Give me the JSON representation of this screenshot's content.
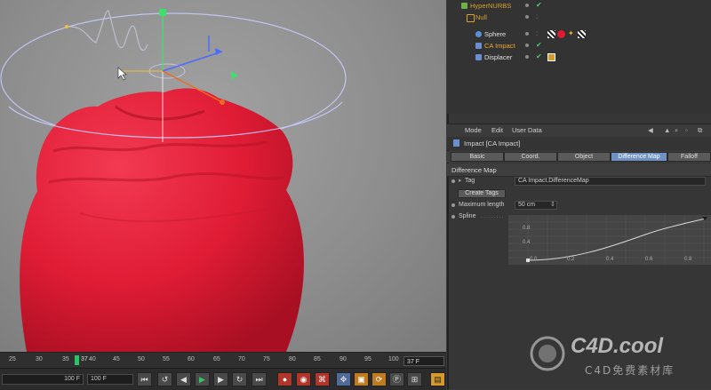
{
  "object_manager": {
    "rows": [
      {
        "name": "HyperNURBS",
        "color": "#d8a22a"
      },
      {
        "name": "Null",
        "color": "#d8a22a"
      },
      {
        "name": "Sphere",
        "color": "#e0e0e0"
      },
      {
        "name": "CA Impact",
        "color": "#f0a830"
      },
      {
        "name": "Displacer",
        "color": "#e0e0e0"
      }
    ]
  },
  "attributes": {
    "menu": [
      "Mode",
      "Edit",
      "User Data"
    ],
    "title": "Impact [CA Impact]",
    "tabs": [
      "Basic",
      "Coord.",
      "Object",
      "Difference Map",
      "Falloff"
    ],
    "active_tab": "Difference Map",
    "section_title": "Difference Map",
    "tag_label": "Tag",
    "tag_value": "CA Impact.DifferenceMap",
    "create_tags_label": "Create Tags",
    "max_length_label": "Maximum length",
    "max_length_value": "50 cm",
    "spline_label": "Spline",
    "spline_y_ticks": [
      "0.8",
      "0.4"
    ],
    "spline_x_ticks": [
      "0.0",
      "0.2",
      "0.4",
      "0.6",
      "0.8"
    ]
  },
  "timeline": {
    "ticks": [
      "25",
      "30",
      "35",
      "37",
      "40",
      "45",
      "50",
      "55",
      "60",
      "65",
      "70",
      "75",
      "80",
      "85",
      "90",
      "95",
      "100"
    ],
    "current_frame": "37 F"
  },
  "transport": {
    "start_field": "100 F",
    "end_field": "100 F"
  },
  "watermark": {
    "logo": "C4D.cool",
    "subtitle": "C4D免费素材库"
  },
  "colors": {
    "object_red": "#e8203a",
    "accent_blue": "#6f92c2",
    "timeline_marker": "#27c46a"
  }
}
